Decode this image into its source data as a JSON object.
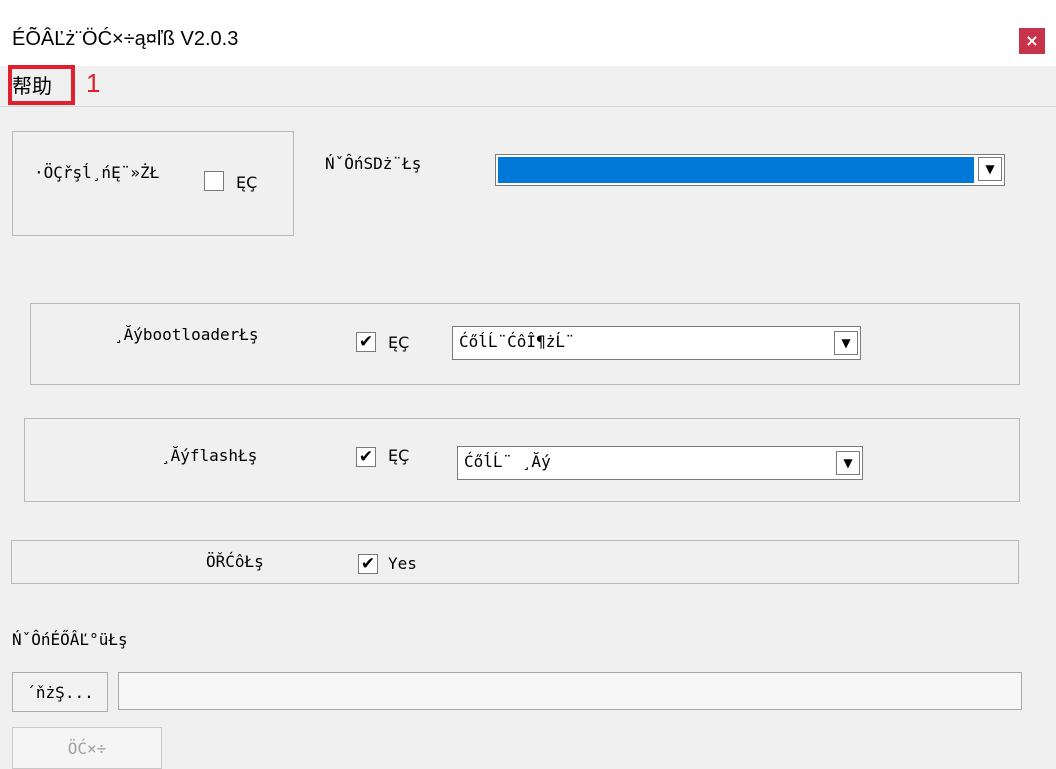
{
  "window": {
    "title": "ÉÕÂĽż¨ÖĆ×÷ą¤ľß V2.0.3",
    "close_label": "×"
  },
  "menu": {
    "items": [
      {
        "label": "帮助"
      }
    ],
    "annotation": "1"
  },
  "section_top": {
    "checkbox_label_left": "·ÖÇřşĺ¸ńĘ¨»ŻŁ",
    "checkbox_mark": "",
    "checkbox_text": "ĘÇ",
    "sd_label": "ŃˇÔńSDż¨Łş",
    "sd_value": ""
  },
  "row_bootloader": {
    "label": "¸ĂýbootloaderŁş",
    "checkbox_mark": "✔",
    "checkbox_text": "ĘÇ",
    "select_value": "ĆőĺĹ¨ĆôÎ¶żĹ¨"
  },
  "row_flash": {
    "label": "¸ĂýflashŁş",
    "checkbox_mark": "✔",
    "checkbox_text": "ĘÇ",
    "select_value": "ĆőĺĹ¨ ¸Ăý"
  },
  "row_verify": {
    "label": "ÖŘĆôŁş",
    "checkbox_mark": "✔",
    "checkbox_text": "Yes"
  },
  "image_section": {
    "label": "ŃˇÔńÉŐÂĽ°üŁş",
    "browse_label": "´ňżŞ...",
    "path_value": ""
  },
  "action": {
    "make_label": "ÖĆ×÷"
  },
  "colors": {
    "accent_blue": "#0078d7",
    "close_red": "#c8334c",
    "annotation_red": "#e0202e"
  }
}
